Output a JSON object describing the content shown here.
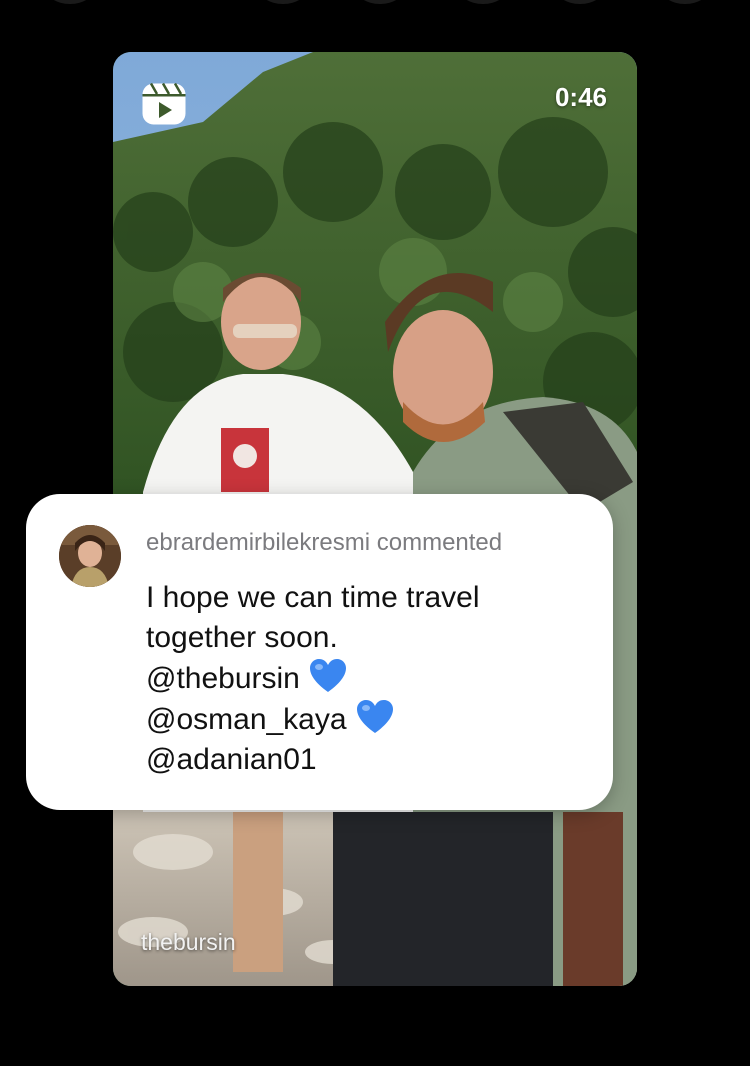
{
  "reel": {
    "duration": "0:46",
    "author": "thebursin",
    "icon": "reels-icon"
  },
  "comment": {
    "header": "ebrardemirbilekresmi commented",
    "lines": [
      "I hope we can time travel",
      "together soon.",
      "@thebursin",
      "@osman_kaya",
      "@adanian01"
    ],
    "heart_color": "#3a86f0"
  }
}
